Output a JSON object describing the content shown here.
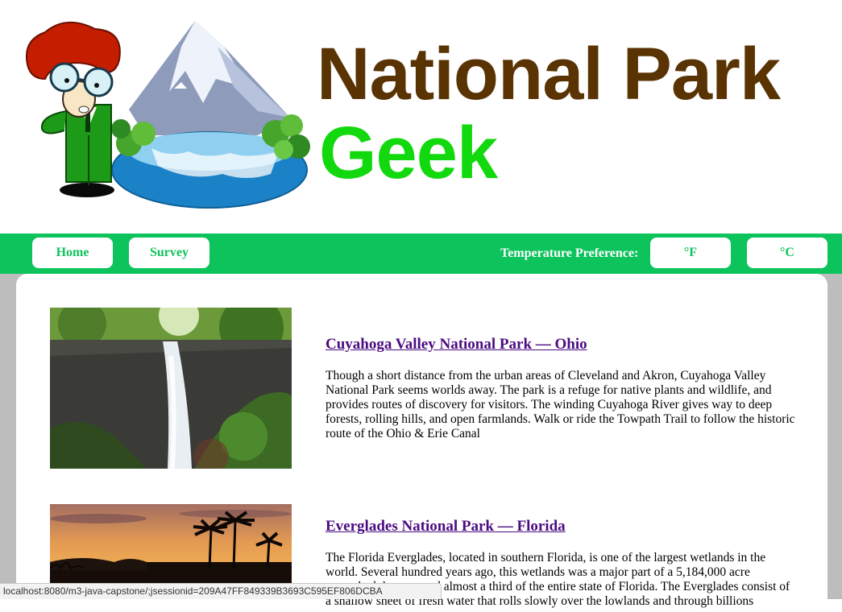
{
  "header": {
    "title_line1": "National Park",
    "title_line2": "Geek"
  },
  "nav": {
    "home_label": "Home",
    "survey_label": "Survey",
    "temp_label": "Temperature Preference:",
    "fahrenheit_label": "°F",
    "celsius_label": "°C"
  },
  "parks": [
    {
      "title": "Cuyahoga Valley National Park — Ohio",
      "description": "Though a short distance from the urban areas of Cleveland and Akron, Cuyahoga Valley National Park seems worlds away. The park is a refuge for native plants and wildlife, and provides routes of discovery for visitors. The winding Cuyahoga River gives way to deep forests, rolling hills, and open farmlands. Walk or ride the Towpath Trail to follow the historic route of the Ohio & Erie Canal"
    },
    {
      "title": "Everglades National Park — Florida",
      "description": "The Florida Everglades, located in southern Florida, is one of the largest wetlands in the world. Several hundred years ago, this wetlands was a major part of a 5,184,000 acre watershed that covered almost a third of the entire state of Florida. The Everglades consist of a shallow sheet of fresh water that rolls slowly over the lowlands and through billions"
    }
  ],
  "status_bar": {
    "url": "localhost:8080/m3-java-capstone/;jsessionid=209A47FF849339B3693C595EF806DCBA"
  },
  "colors": {
    "nav_green": "#0dc35c",
    "title_brown": "#5a3303",
    "title_green": "#12d80e",
    "link_purple": "#4b0b82"
  }
}
